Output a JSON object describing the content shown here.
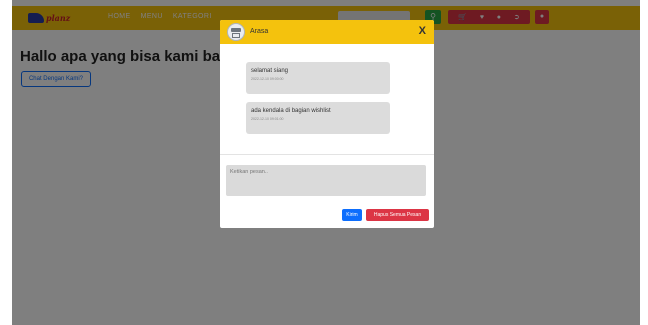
{
  "navbar": {
    "logo_text": "planz",
    "links": [
      "HOME",
      "MENU",
      "KATEGORI",
      "",
      "",
      ""
    ],
    "search_icon": "search-icon",
    "icons": [
      "cart-icon",
      "heart-icon",
      "chat-icon",
      "logout-icon"
    ],
    "user_icon": "user-icon"
  },
  "page": {
    "heading": "Hallo apa yang bisa kami bantu",
    "chat_button": "Chat Dengan Kami?"
  },
  "modal": {
    "title": "Arasa",
    "close": "X",
    "messages": [
      {
        "text": "selamat siang",
        "time": "2022-12-10 09:00:00"
      },
      {
        "text": "ada kendala di bagian wishlist",
        "time": "2022-12-10 09:01:00"
      }
    ],
    "input_placeholder": "Ketikan pesan..",
    "send_label": "Kirim",
    "clear_label": "Hapus Semua Pesan"
  },
  "colors": {
    "navbar": "#f4c20d",
    "primary": "#0d6efd",
    "danger": "#dc3545",
    "success": "#28a745"
  }
}
